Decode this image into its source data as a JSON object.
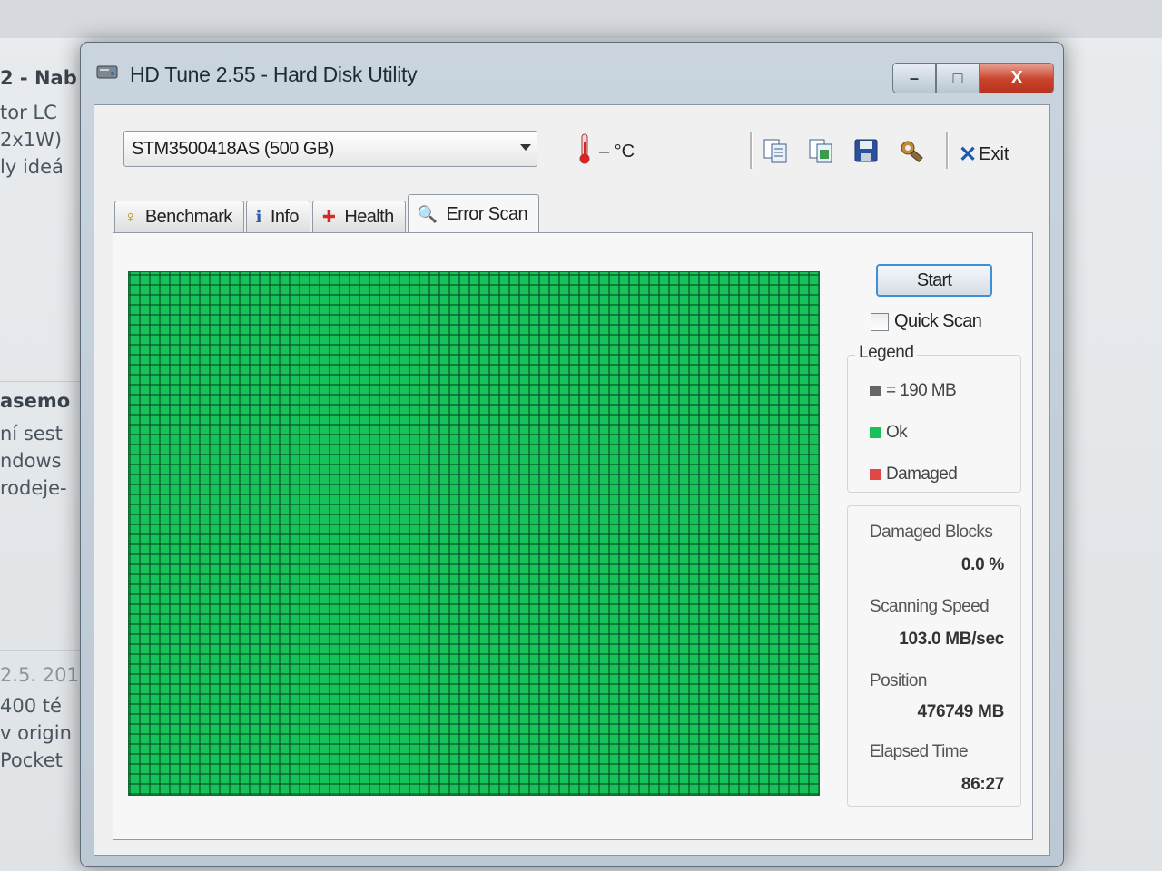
{
  "background_page": {
    "lines": [
      {
        "text": "2 - Nab",
        "style": "bold"
      },
      {
        "text": "tor LC",
        "style": "normal"
      },
      {
        "text": "2x1W)",
        "style": "normal"
      },
      {
        "text": "ly ideá",
        "style": "normal"
      },
      {
        "text": "asemo",
        "style": "bold"
      },
      {
        "text": "ní sest",
        "style": "normal"
      },
      {
        "text": "ndows",
        "style": "normal"
      },
      {
        "text": "rodeje-",
        "style": "normal"
      },
      {
        "text": "2.5. 201",
        "style": "light"
      },
      {
        "text": "400 té",
        "style": "normal"
      },
      {
        "text": "v origin",
        "style": "normal"
      },
      {
        "text": "Pocket",
        "style": "normal"
      }
    ]
  },
  "window": {
    "title": "HD Tune 2.55 - Hard Disk Utility",
    "buttons": {
      "minimize": "–",
      "maximize": "□",
      "close": "X"
    }
  },
  "toolbar": {
    "drive": "STM3500418AS (500 GB)",
    "temperature": "– °C",
    "icons": [
      "copy-text-icon",
      "copy-image-icon",
      "save-icon",
      "options-icon"
    ],
    "exit_label": "Exit"
  },
  "tabs": [
    {
      "label": "Benchmark",
      "icon": "benchmark-icon",
      "glyph": "♀",
      "active": false
    },
    {
      "label": "Info",
      "icon": "info-icon",
      "glyph": "ℹ",
      "active": false
    },
    {
      "label": "Health",
      "icon": "health-icon",
      "glyph": "✚",
      "active": false
    },
    {
      "label": "Error Scan",
      "icon": "magnifier-icon",
      "glyph": "🔍",
      "active": true
    }
  ],
  "error_scan": {
    "start_label": "Start",
    "quick_scan_label": "Quick Scan",
    "quick_scan_checked": false,
    "legend": {
      "title": "Legend",
      "block_size": "= 190 MB",
      "ok": "Ok",
      "damaged": "Damaged"
    },
    "stats": {
      "damaged_blocks_label": "Damaged Blocks",
      "damaged_blocks_value": "0.0 %",
      "scanning_speed_label": "Scanning Speed",
      "scanning_speed_value": "103.0 MB/sec",
      "position_label": "Position",
      "position_value": "476749 MB",
      "elapsed_time_label": "Elapsed Time",
      "elapsed_time_value": "86:27"
    },
    "grid_status": "all-ok"
  },
  "colors": {
    "ok": "#17c25a",
    "damaged": "#e04848",
    "block": "#666666",
    "accent": "#3e8fd4"
  }
}
